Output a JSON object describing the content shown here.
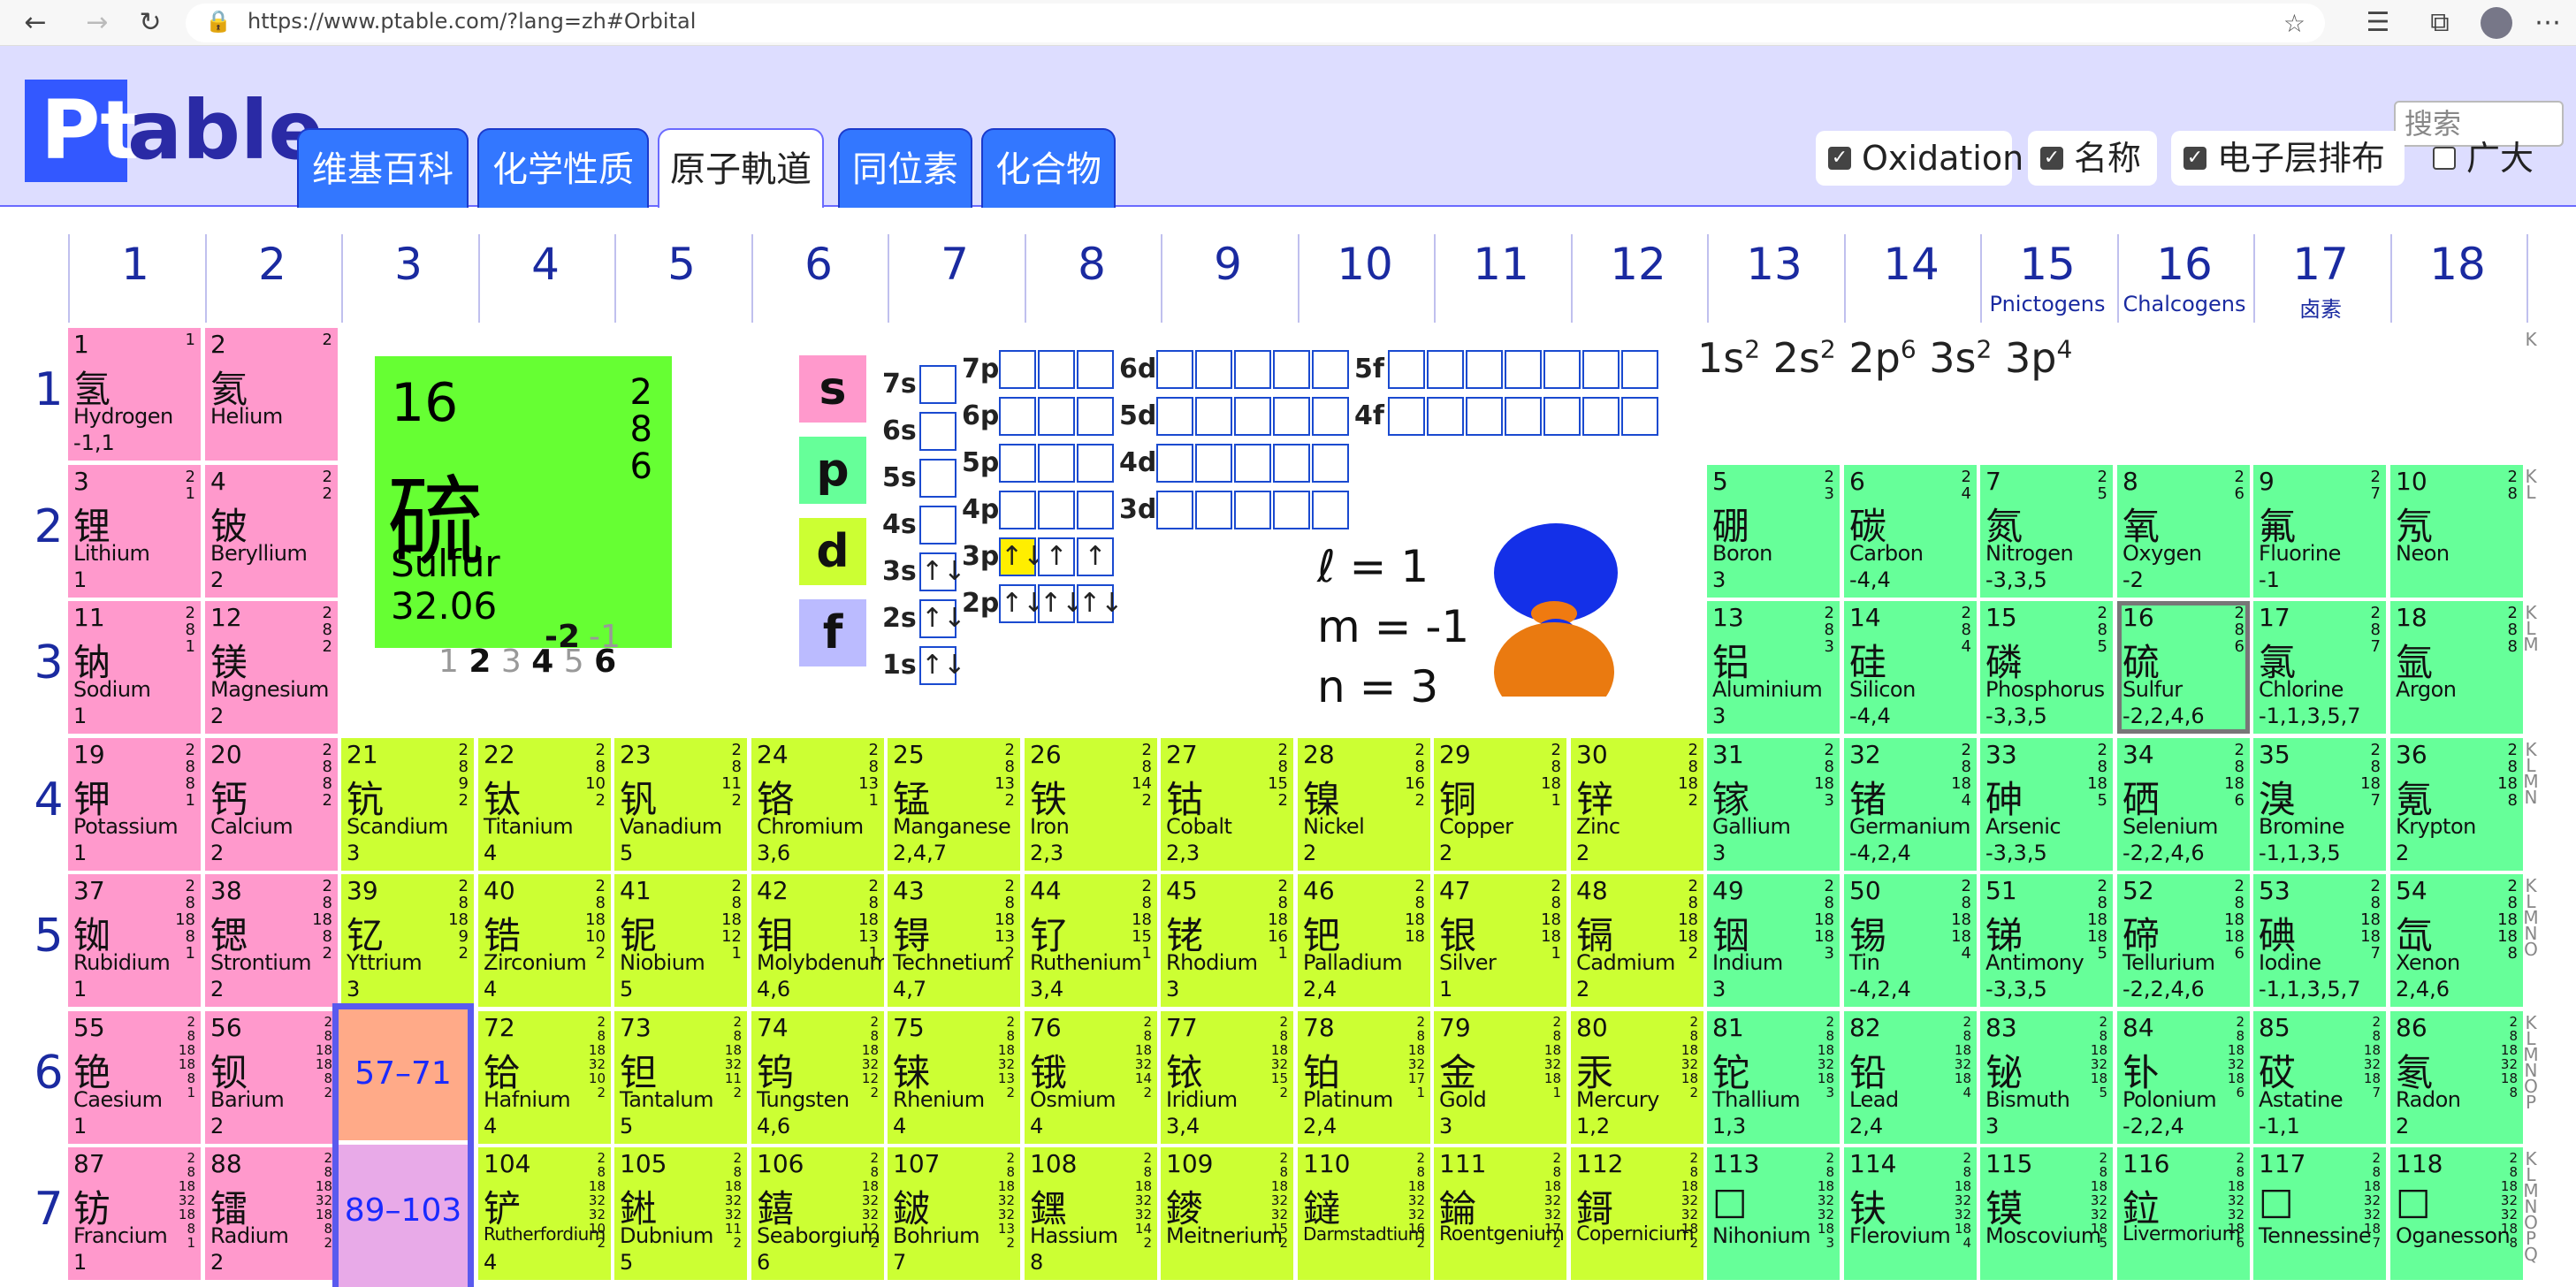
{
  "browser": {
    "url": "https://www.ptable.com/?lang=zh#Orbital"
  },
  "logo": {
    "pt": "Pt",
    "able": "able"
  },
  "search": {
    "placeholder": "搜索"
  },
  "tabs": [
    {
      "label": "维基百科"
    },
    {
      "label": "化学性质"
    },
    {
      "label": "原子軌道"
    },
    {
      "label": "同位素"
    },
    {
      "label": "化合物"
    }
  ],
  "toggles": [
    {
      "label": "Oxidation",
      "checked": true
    },
    {
      "label": "名称",
      "checked": true
    },
    {
      "label": "电子层排布",
      "checked": true
    },
    {
      "label": "广大",
      "checked": false
    }
  ],
  "groups": [
    "1",
    "2",
    "3",
    "4",
    "5",
    "6",
    "7",
    "8",
    "9",
    "10",
    "11",
    "12",
    "13",
    "14",
    "15",
    "16",
    "17",
    "18"
  ],
  "group_subtitles": {
    "15": "Pnictogens",
    "16": "Chalcogens",
    "17": "卤素"
  },
  "periods": [
    "1",
    "2",
    "3",
    "4",
    "5",
    "6",
    "7"
  ],
  "shell_letters": [
    "K",
    "KL",
    "KLM",
    "KLMN",
    "KLMNO",
    "KLMNOP",
    "KLMNOPQ"
  ],
  "selected": {
    "number": "16",
    "symbol": "硫",
    "name": "Sulfur",
    "weight": "32.06",
    "shells": "2\n8\n6",
    "ox_pre": "1 ",
    "ox_b2": "2",
    "ox_3": " 3 ",
    "ox_b4": "4",
    "ox_5": " 5 ",
    "ox_b6": "6",
    "ox_neg": "-2",
    "ox_neg1": "-1"
  },
  "config": {
    "text": "1s2 2s2 2p6 3s2 3p4"
  },
  "orbitals": {
    "s": "s",
    "p": "p",
    "d": "d",
    "f": "f"
  },
  "levels": {
    "s": [
      "7s",
      "6s",
      "5s",
      "4s",
      "3s",
      "2s",
      "1s"
    ],
    "p": [
      "7p",
      "6p",
      "5p",
      "4p",
      "3p",
      "2p"
    ],
    "d": [
      "6d",
      "5d",
      "4d",
      "3d"
    ],
    "f": [
      "5f",
      "4f"
    ]
  },
  "fills": {
    "3s": "↑↓",
    "2s": "↑↓",
    "1s": "↑↓",
    "3p": [
      "↑↓",
      "↑",
      "↑"
    ],
    "2p": [
      "↑↓",
      "↑↓",
      "↑↓"
    ]
  },
  "quantum": {
    "l": "ℓ = 1",
    "m": "m = -1",
    "n": "n = 3"
  },
  "series_labels": {
    "lanthanides": "57–71",
    "actinides": "89–103"
  },
  "colors": {
    "alkali": "#ff99cc",
    "nonmetal": "#66ff99",
    "transition": "#ccff33",
    "highlight": "#66ff33"
  },
  "elements": [
    {
      "n": "1",
      "zh": "氢",
      "en": "Hydrogen",
      "ox": "-1,1",
      "sh": "1",
      "g": 1,
      "p": 1,
      "c": "alk"
    },
    {
      "n": "2",
      "zh": "氦",
      "en": "Helium",
      "ox": "",
      "sh": "2",
      "g": 2,
      "p": 1,
      "c": "alk"
    },
    {
      "n": "3",
      "zh": "锂",
      "en": "Lithium",
      "ox": "1",
      "sh": "2\n1",
      "g": 1,
      "p": 2,
      "c": "alk"
    },
    {
      "n": "4",
      "zh": "铍",
      "en": "Beryllium",
      "ox": "2",
      "sh": "2\n2",
      "g": 2,
      "p": 2,
      "c": "alk"
    },
    {
      "n": "5",
      "zh": "硼",
      "en": "Boron",
      "ox": "3",
      "sh": "2\n3",
      "g": 13,
      "p": 2,
      "c": "nm"
    },
    {
      "n": "6",
      "zh": "碳",
      "en": "Carbon",
      "ox": "-4,4",
      "sh": "2\n4",
      "g": 14,
      "p": 2,
      "c": "nm"
    },
    {
      "n": "7",
      "zh": "氮",
      "en": "Nitrogen",
      "ox": "-3,3,5",
      "sh": "2\n5",
      "g": 15,
      "p": 2,
      "c": "nm"
    },
    {
      "n": "8",
      "zh": "氧",
      "en": "Oxygen",
      "ox": "-2",
      "sh": "2\n6",
      "g": 16,
      "p": 2,
      "c": "nm"
    },
    {
      "n": "9",
      "zh": "氟",
      "en": "Fluorine",
      "ox": "-1",
      "sh": "2\n7",
      "g": 17,
      "p": 2,
      "c": "nm"
    },
    {
      "n": "10",
      "zh": "氖",
      "en": "Neon",
      "ox": "",
      "sh": "2\n8",
      "g": 18,
      "p": 2,
      "c": "nm"
    },
    {
      "n": "11",
      "zh": "钠",
      "en": "Sodium",
      "ox": "1",
      "sh": "2\n8\n1",
      "g": 1,
      "p": 3,
      "c": "alk"
    },
    {
      "n": "12",
      "zh": "镁",
      "en": "Magnesium",
      "ox": "2",
      "sh": "2\n8\n2",
      "g": 2,
      "p": 3,
      "c": "alk"
    },
    {
      "n": "13",
      "zh": "铝",
      "en": "Aluminium",
      "ox": "3",
      "sh": "2\n8\n3",
      "g": 13,
      "p": 3,
      "c": "nm"
    },
    {
      "n": "14",
      "zh": "硅",
      "en": "Silicon",
      "ox": "-4,4",
      "sh": "2\n8\n4",
      "g": 14,
      "p": 3,
      "c": "nm"
    },
    {
      "n": "15",
      "zh": "磷",
      "en": "Phosphorus",
      "ox": "-3,3,5",
      "sh": "2\n8\n5",
      "g": 15,
      "p": 3,
      "c": "nm"
    },
    {
      "n": "16",
      "zh": "硫",
      "en": "Sulfur",
      "ox": "-2,2,4,6",
      "sh": "2\n8\n6",
      "g": 16,
      "p": 3,
      "c": "nm",
      "sel": true
    },
    {
      "n": "17",
      "zh": "氯",
      "en": "Chlorine",
      "ox": "-1,1,3,5,7",
      "sh": "2\n8\n7",
      "g": 17,
      "p": 3,
      "c": "nm"
    },
    {
      "n": "18",
      "zh": "氩",
      "en": "Argon",
      "ox": "",
      "sh": "2\n8\n8",
      "g": 18,
      "p": 3,
      "c": "nm"
    },
    {
      "n": "19",
      "zh": "钾",
      "en": "Potassium",
      "ox": "1",
      "sh": "2\n8\n8\n1",
      "g": 1,
      "p": 4,
      "c": "alk"
    },
    {
      "n": "20",
      "zh": "钙",
      "en": "Calcium",
      "ox": "2",
      "sh": "2\n8\n8\n2",
      "g": 2,
      "p": 4,
      "c": "alk"
    },
    {
      "n": "21",
      "zh": "钪",
      "en": "Scandium",
      "ox": "3",
      "sh": "2\n8\n9\n2",
      "g": 3,
      "p": 4,
      "c": "tm"
    },
    {
      "n": "22",
      "zh": "钛",
      "en": "Titanium",
      "ox": "4",
      "sh": "2\n8\n10\n2",
      "g": 4,
      "p": 4,
      "c": "tm"
    },
    {
      "n": "23",
      "zh": "钒",
      "en": "Vanadium",
      "ox": "5",
      "sh": "2\n8\n11\n2",
      "g": 5,
      "p": 4,
      "c": "tm"
    },
    {
      "n": "24",
      "zh": "铬",
      "en": "Chromium",
      "ox": "3,6",
      "sh": "2\n8\n13\n1",
      "g": 6,
      "p": 4,
      "c": "tm"
    },
    {
      "n": "25",
      "zh": "锰",
      "en": "Manganese",
      "ox": "2,4,7",
      "sh": "2\n8\n13\n2",
      "g": 7,
      "p": 4,
      "c": "tm"
    },
    {
      "n": "26",
      "zh": "铁",
      "en": "Iron",
      "ox": "2,3",
      "sh": "2\n8\n14\n2",
      "g": 8,
      "p": 4,
      "c": "tm"
    },
    {
      "n": "27",
      "zh": "钴",
      "en": "Cobalt",
      "ox": "2,3",
      "sh": "2\n8\n15\n2",
      "g": 9,
      "p": 4,
      "c": "tm"
    },
    {
      "n": "28",
      "zh": "镍",
      "en": "Nickel",
      "ox": "2",
      "sh": "2\n8\n16\n2",
      "g": 10,
      "p": 4,
      "c": "tm"
    },
    {
      "n": "29",
      "zh": "铜",
      "en": "Copper",
      "ox": "2",
      "sh": "2\n8\n18\n1",
      "g": 11,
      "p": 4,
      "c": "tm"
    },
    {
      "n": "30",
      "zh": "锌",
      "en": "Zinc",
      "ox": "2",
      "sh": "2\n8\n18\n2",
      "g": 12,
      "p": 4,
      "c": "tm"
    },
    {
      "n": "31",
      "zh": "镓",
      "en": "Gallium",
      "ox": "3",
      "sh": "2\n8\n18\n3",
      "g": 13,
      "p": 4,
      "c": "nm"
    },
    {
      "n": "32",
      "zh": "锗",
      "en": "Germanium",
      "ox": "-4,2,4",
      "sh": "2\n8\n18\n4",
      "g": 14,
      "p": 4,
      "c": "nm"
    },
    {
      "n": "33",
      "zh": "砷",
      "en": "Arsenic",
      "ox": "-3,3,5",
      "sh": "2\n8\n18\n5",
      "g": 15,
      "p": 4,
      "c": "nm"
    },
    {
      "n": "34",
      "zh": "硒",
      "en": "Selenium",
      "ox": "-2,2,4,6",
      "sh": "2\n8\n18\n6",
      "g": 16,
      "p": 4,
      "c": "nm"
    },
    {
      "n": "35",
      "zh": "溴",
      "en": "Bromine",
      "ox": "-1,1,3,5",
      "sh": "2\n8\n18\n7",
      "g": 17,
      "p": 4,
      "c": "nm"
    },
    {
      "n": "36",
      "zh": "氪",
      "en": "Krypton",
      "ox": "2",
      "sh": "2\n8\n18\n8",
      "g": 18,
      "p": 4,
      "c": "nm"
    },
    {
      "n": "37",
      "zh": "铷",
      "en": "Rubidium",
      "ox": "1",
      "sh": "2\n8\n18\n8\n1",
      "g": 1,
      "p": 5,
      "c": "alk"
    },
    {
      "n": "38",
      "zh": "锶",
      "en": "Strontium",
      "ox": "2",
      "sh": "2\n8\n18\n8\n2",
      "g": 2,
      "p": 5,
      "c": "alk"
    },
    {
      "n": "39",
      "zh": "钇",
      "en": "Yttrium",
      "ox": "3",
      "sh": "2\n8\n18\n9\n2",
      "g": 3,
      "p": 5,
      "c": "tm"
    },
    {
      "n": "40",
      "zh": "锆",
      "en": "Zirconium",
      "ox": "4",
      "sh": "2\n8\n18\n10\n2",
      "g": 4,
      "p": 5,
      "c": "tm"
    },
    {
      "n": "41",
      "zh": "铌",
      "en": "Niobium",
      "ox": "5",
      "sh": "2\n8\n18\n12\n1",
      "g": 5,
      "p": 5,
      "c": "tm"
    },
    {
      "n": "42",
      "zh": "钼",
      "en": "Molybdenum",
      "ox": "4,6",
      "sh": "2\n8\n18\n13\n1",
      "g": 6,
      "p": 5,
      "c": "tm"
    },
    {
      "n": "43",
      "zh": "锝",
      "en": "Technetium",
      "ox": "4,7",
      "sh": "2\n8\n18\n13\n2",
      "g": 7,
      "p": 5,
      "c": "tm"
    },
    {
      "n": "44",
      "zh": "钌",
      "en": "Ruthenium",
      "ox": "3,4",
      "sh": "2\n8\n18\n15\n1",
      "g": 8,
      "p": 5,
      "c": "tm"
    },
    {
      "n": "45",
      "zh": "铑",
      "en": "Rhodium",
      "ox": "3",
      "sh": "2\n8\n18\n16\n1",
      "g": 9,
      "p": 5,
      "c": "tm"
    },
    {
      "n": "46",
      "zh": "钯",
      "en": "Palladium",
      "ox": "2,4",
      "sh": "2\n8\n18\n18",
      "g": 10,
      "p": 5,
      "c": "tm"
    },
    {
      "n": "47",
      "zh": "银",
      "en": "Silver",
      "ox": "1",
      "sh": "2\n8\n18\n18\n1",
      "g": 11,
      "p": 5,
      "c": "tm"
    },
    {
      "n": "48",
      "zh": "镉",
      "en": "Cadmium",
      "ox": "2",
      "sh": "2\n8\n18\n18\n2",
      "g": 12,
      "p": 5,
      "c": "tm"
    },
    {
      "n": "49",
      "zh": "铟",
      "en": "Indium",
      "ox": "3",
      "sh": "2\n8\n18\n18\n3",
      "g": 13,
      "p": 5,
      "c": "nm"
    },
    {
      "n": "50",
      "zh": "锡",
      "en": "Tin",
      "ox": "-4,2,4",
      "sh": "2\n8\n18\n18\n4",
      "g": 14,
      "p": 5,
      "c": "nm"
    },
    {
      "n": "51",
      "zh": "锑",
      "en": "Antimony",
      "ox": "-3,3,5",
      "sh": "2\n8\n18\n18\n5",
      "g": 15,
      "p": 5,
      "c": "nm"
    },
    {
      "n": "52",
      "zh": "碲",
      "en": "Tellurium",
      "ox": "-2,2,4,6",
      "sh": "2\n8\n18\n18\n6",
      "g": 16,
      "p": 5,
      "c": "nm"
    },
    {
      "n": "53",
      "zh": "碘",
      "en": "Iodine",
      "ox": "-1,1,3,5,7",
      "sh": "2\n8\n18\n18\n7",
      "g": 17,
      "p": 5,
      "c": "nm"
    },
    {
      "n": "54",
      "zh": "氙",
      "en": "Xenon",
      "ox": "2,4,6",
      "sh": "2\n8\n18\n18\n8",
      "g": 18,
      "p": 5,
      "c": "nm"
    },
    {
      "n": "55",
      "zh": "铯",
      "en": "Caesium",
      "ox": "1",
      "sh": "2\n8\n18\n18\n8\n1",
      "g": 1,
      "p": 6,
      "c": "alk"
    },
    {
      "n": "56",
      "zh": "钡",
      "en": "Barium",
      "ox": "2",
      "sh": "2\n8\n18\n18\n8\n2",
      "g": 2,
      "p": 6,
      "c": "alk"
    },
    {
      "n": "72",
      "zh": "铪",
      "en": "Hafnium",
      "ox": "4",
      "sh": "2\n8\n18\n32\n10\n2",
      "g": 4,
      "p": 6,
      "c": "tm"
    },
    {
      "n": "73",
      "zh": "钽",
      "en": "Tantalum",
      "ox": "5",
      "sh": "2\n8\n18\n32\n11\n2",
      "g": 5,
      "p": 6,
      "c": "tm"
    },
    {
      "n": "74",
      "zh": "钨",
      "en": "Tungsten",
      "ox": "4,6",
      "sh": "2\n8\n18\n32\n12\n2",
      "g": 6,
      "p": 6,
      "c": "tm"
    },
    {
      "n": "75",
      "zh": "铼",
      "en": "Rhenium",
      "ox": "4",
      "sh": "2\n8\n18\n32\n13\n2",
      "g": 7,
      "p": 6,
      "c": "tm"
    },
    {
      "n": "76",
      "zh": "锇",
      "en": "Osmium",
      "ox": "4",
      "sh": "2\n8\n18\n32\n14\n2",
      "g": 8,
      "p": 6,
      "c": "tm"
    },
    {
      "n": "77",
      "zh": "铱",
      "en": "Iridium",
      "ox": "3,4",
      "sh": "2\n8\n18\n32\n15\n2",
      "g": 9,
      "p": 6,
      "c": "tm"
    },
    {
      "n": "78",
      "zh": "铂",
      "en": "Platinum",
      "ox": "2,4",
      "sh": "2\n8\n18\n32\n17\n1",
      "g": 10,
      "p": 6,
      "c": "tm"
    },
    {
      "n": "79",
      "zh": "金",
      "en": "Gold",
      "ox": "3",
      "sh": "2\n8\n18\n32\n18\n1",
      "g": 11,
      "p": 6,
      "c": "tm"
    },
    {
      "n": "80",
      "zh": "汞",
      "en": "Mercury",
      "ox": "1,2",
      "sh": "2\n8\n18\n32\n18\n2",
      "g": 12,
      "p": 6,
      "c": "tm"
    },
    {
      "n": "81",
      "zh": "铊",
      "en": "Thallium",
      "ox": "1,3",
      "sh": "2\n8\n18\n32\n18\n3",
      "g": 13,
      "p": 6,
      "c": "nm"
    },
    {
      "n": "82",
      "zh": "铅",
      "en": "Lead",
      "ox": "2,4",
      "sh": "2\n8\n18\n32\n18\n4",
      "g": 14,
      "p": 6,
      "c": "nm"
    },
    {
      "n": "83",
      "zh": "铋",
      "en": "Bismuth",
      "ox": "3",
      "sh": "2\n8\n18\n32\n18\n5",
      "g": 15,
      "p": 6,
      "c": "nm"
    },
    {
      "n": "84",
      "zh": "钋",
      "en": "Polonium",
      "ox": "-2,2,4",
      "sh": "2\n8\n18\n32\n18\n6",
      "g": 16,
      "p": 6,
      "c": "nm"
    },
    {
      "n": "85",
      "zh": "砹",
      "en": "Astatine",
      "ox": "-1,1",
      "sh": "2\n8\n18\n32\n18\n7",
      "g": 17,
      "p": 6,
      "c": "nm"
    },
    {
      "n": "86",
      "zh": "氡",
      "en": "Radon",
      "ox": "2",
      "sh": "2\n8\n18\n32\n18\n8",
      "g": 18,
      "p": 6,
      "c": "nm"
    },
    {
      "n": "87",
      "zh": "钫",
      "en": "Francium",
      "ox": "1",
      "sh": "2\n8\n18\n32\n18\n8\n1",
      "g": 1,
      "p": 7,
      "c": "alk"
    },
    {
      "n": "88",
      "zh": "镭",
      "en": "Radium",
      "ox": "2",
      "sh": "2\n8\n18\n32\n18\n8\n2",
      "g": 2,
      "p": 7,
      "c": "alk"
    },
    {
      "n": "104",
      "zh": "铲",
      "en": "Rutherfordium",
      "ox": "4",
      "sh": "2\n8\n18\n32\n32\n10\n2",
      "g": 4,
      "p": 7,
      "c": "tm"
    },
    {
      "n": "105",
      "zh": "𨧀",
      "en": "Dubnium",
      "ox": "5",
      "sh": "2\n8\n18\n32\n32\n11\n2",
      "g": 5,
      "p": 7,
      "c": "tm"
    },
    {
      "n": "106",
      "zh": "𨭎",
      "en": "Seaborgium",
      "ox": "6",
      "sh": "2\n8\n18\n32\n32\n12\n2",
      "g": 6,
      "p": 7,
      "c": "tm"
    },
    {
      "n": "107",
      "zh": "𨨏",
      "en": "Bohrium",
      "ox": "7",
      "sh": "2\n8\n18\n32\n32\n13\n2",
      "g": 7,
      "p": 7,
      "c": "tm"
    },
    {
      "n": "108",
      "zh": "𨭆",
      "en": "Hassium",
      "ox": "8",
      "sh": "2\n8\n18\n32\n32\n14\n2",
      "g": 8,
      "p": 7,
      "c": "tm"
    },
    {
      "n": "109",
      "zh": "䥑",
      "en": "Meitnerium",
      "ox": "",
      "sh": "2\n8\n18\n32\n32\n15\n2",
      "g": 9,
      "p": 7,
      "c": "tm"
    },
    {
      "n": "110",
      "zh": "鐽",
      "en": "Darmstadtium",
      "ox": "",
      "sh": "2\n8\n18\n32\n32\n16\n2",
      "g": 10,
      "p": 7,
      "c": "tm"
    },
    {
      "n": "111",
      "zh": "錀",
      "en": "Roentgenium",
      "ox": "",
      "sh": "2\n8\n18\n32\n32\n17\n2",
      "g": 11,
      "p": 7,
      "c": "tm"
    },
    {
      "n": "112",
      "zh": "鎶",
      "en": "Copernicium",
      "ox": "",
      "sh": "2\n8\n18\n32\n32\n18\n2",
      "g": 12,
      "p": 7,
      "c": "tm"
    },
    {
      "n": "113",
      "zh": "□",
      "en": "Nihonium",
      "ox": "",
      "sh": "2\n8\n18\n32\n32\n18\n3",
      "g": 13,
      "p": 7,
      "c": "nm"
    },
    {
      "n": "114",
      "zh": "𫓧",
      "en": "Flerovium",
      "ox": "",
      "sh": "2\n8\n18\n32\n32\n18\n4",
      "g": 14,
      "p": 7,
      "c": "nm"
    },
    {
      "n": "115",
      "zh": "镆",
      "en": "Moscovium",
      "ox": "",
      "sh": "2\n8\n18\n32\n32\n18\n5",
      "g": 15,
      "p": 7,
      "c": "nm"
    },
    {
      "n": "116",
      "zh": "鉝",
      "en": "Livermorium",
      "ox": "",
      "sh": "2\n8\n18\n32\n32\n18\n6",
      "g": 16,
      "p": 7,
      "c": "nm"
    },
    {
      "n": "117",
      "zh": "□",
      "en": "Tennessine",
      "ox": "",
      "sh": "2\n8\n18\n32\n32\n18\n7",
      "g": 17,
      "p": 7,
      "c": "nm"
    },
    {
      "n": "118",
      "zh": "□",
      "en": "Oganesson",
      "ox": "",
      "sh": "2\n8\n18\n32\n32\n18\n8",
      "g": 18,
      "p": 7,
      "c": "nm"
    }
  ]
}
